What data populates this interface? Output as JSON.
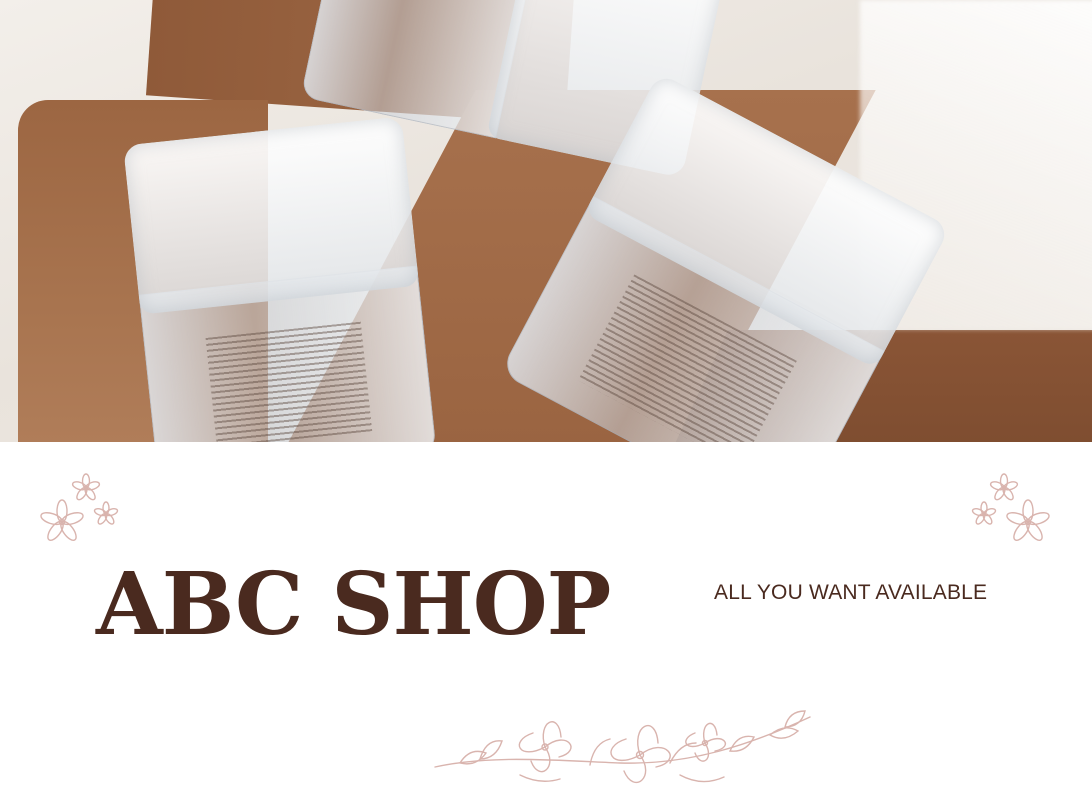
{
  "brand": {
    "name": "ABC SHOP",
    "tagline": "ALL YOU WANT AVAILABLE"
  },
  "colors": {
    "title": "#4a2a1f",
    "floral": "#d9b4ae",
    "shadow_brown": "#a56f4c",
    "background": "#ffffff"
  },
  "icons": {
    "top_left": "flower-cluster-icon",
    "top_right": "flower-cluster-icon",
    "bottom": "floral-branch-icon"
  }
}
